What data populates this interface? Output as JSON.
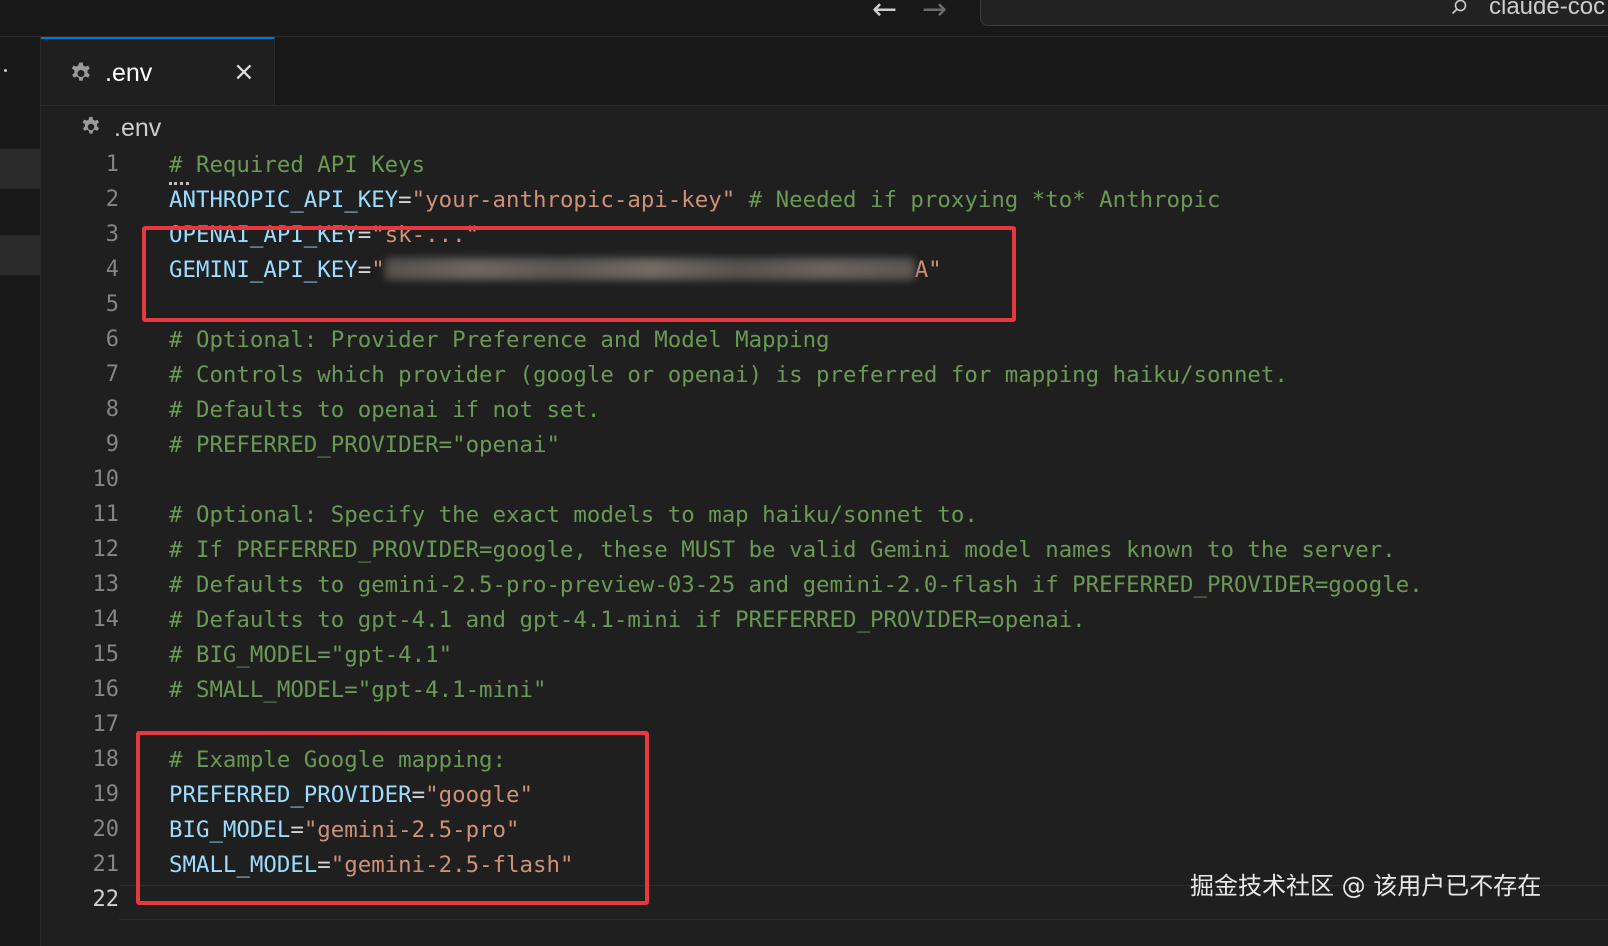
{
  "titlebar": {
    "back_icon": "arrow-left-icon",
    "forward_icon": "arrow-right-icon",
    "search_text": "claude-coc"
  },
  "tab": {
    "label": ".env",
    "icon": "gear-icon",
    "close_symbol": "×"
  },
  "breadcrumb": {
    "label": ".env",
    "icon": "gear-icon"
  },
  "editor": {
    "active_line": 22,
    "lines": [
      {
        "n": "1",
        "segments": [
          {
            "cls": "cmt",
            "text": "# Required API Keys"
          }
        ]
      },
      {
        "n": "2",
        "segments": [
          {
            "cls": "key",
            "text": "ANTHROPIC_API_KEY"
          },
          {
            "cls": "op",
            "text": "="
          },
          {
            "cls": "str",
            "text": "\"your-anthropic-api-key\""
          },
          {
            "cls": "cmt",
            "text": " # Needed if proxying *to* Anthropic"
          }
        ]
      },
      {
        "n": "3",
        "segments": [
          {
            "cls": "key",
            "text": "OPENAI_API_KEY"
          },
          {
            "cls": "op",
            "text": "="
          },
          {
            "cls": "str",
            "text": "\"sk-...\""
          }
        ]
      },
      {
        "n": "4",
        "segments": [
          {
            "cls": "key",
            "text": "GEMINI_API_KEY"
          },
          {
            "cls": "op",
            "text": "="
          },
          {
            "cls": "str",
            "text": "\""
          },
          {
            "cls": "blur",
            "text": ""
          },
          {
            "cls": "str",
            "text": "A\""
          }
        ]
      },
      {
        "n": "5",
        "segments": []
      },
      {
        "n": "6",
        "segments": [
          {
            "cls": "cmt",
            "text": "# Optional: Provider Preference and Model Mapping"
          }
        ]
      },
      {
        "n": "7",
        "segments": [
          {
            "cls": "cmt",
            "text": "# Controls which provider (google or openai) is preferred for mapping haiku/sonnet."
          }
        ]
      },
      {
        "n": "8",
        "segments": [
          {
            "cls": "cmt",
            "text": "# Defaults to openai if not set."
          }
        ]
      },
      {
        "n": "9",
        "segments": [
          {
            "cls": "cmt",
            "text": "# PREFERRED_PROVIDER=\"openai\""
          }
        ]
      },
      {
        "n": "10",
        "segments": []
      },
      {
        "n": "11",
        "segments": [
          {
            "cls": "cmt",
            "text": "# Optional: Specify the exact models to map haiku/sonnet to."
          }
        ]
      },
      {
        "n": "12",
        "segments": [
          {
            "cls": "cmt",
            "text": "# If PREFERRED_PROVIDER=google, these MUST be valid Gemini model names known to the server."
          }
        ]
      },
      {
        "n": "13",
        "segments": [
          {
            "cls": "cmt",
            "text": "# Defaults to gemini-2.5-pro-preview-03-25 and gemini-2.0-flash if PREFERRED_PROVIDER=google."
          }
        ]
      },
      {
        "n": "14",
        "segments": [
          {
            "cls": "cmt",
            "text": "# Defaults to gpt-4.1 and gpt-4.1-mini if PREFERRED_PROVIDER=openai."
          }
        ]
      },
      {
        "n": "15",
        "segments": [
          {
            "cls": "cmt",
            "text": "# BIG_MODEL=\"gpt-4.1\""
          }
        ]
      },
      {
        "n": "16",
        "segments": [
          {
            "cls": "cmt",
            "text": "# SMALL_MODEL=\"gpt-4.1-mini\""
          }
        ]
      },
      {
        "n": "17",
        "segments": []
      },
      {
        "n": "18",
        "segments": [
          {
            "cls": "cmt",
            "text": "# Example Google mapping:"
          }
        ]
      },
      {
        "n": "19",
        "segments": [
          {
            "cls": "key",
            "text": "PREFERRED_PROVIDER"
          },
          {
            "cls": "op",
            "text": "="
          },
          {
            "cls": "str",
            "text": "\"google\""
          }
        ]
      },
      {
        "n": "20",
        "segments": [
          {
            "cls": "key",
            "text": "BIG_MODEL"
          },
          {
            "cls": "op",
            "text": "="
          },
          {
            "cls": "str",
            "text": "\"gemini-2.5-pro\""
          }
        ]
      },
      {
        "n": "21",
        "segments": [
          {
            "cls": "key",
            "text": "SMALL_MODEL"
          },
          {
            "cls": "op",
            "text": "="
          },
          {
            "cls": "str",
            "text": "\"gemini-2.5-flash\""
          }
        ]
      },
      {
        "n": "22",
        "segments": []
      }
    ]
  },
  "colors": {
    "comment": "#6a9955",
    "key": "#9cdcfe",
    "string": "#ce9178",
    "highlight_box": "#e5393f",
    "tab_accent": "#0078d4"
  },
  "watermark": "掘金技术社区 @ 该用户已不存在"
}
